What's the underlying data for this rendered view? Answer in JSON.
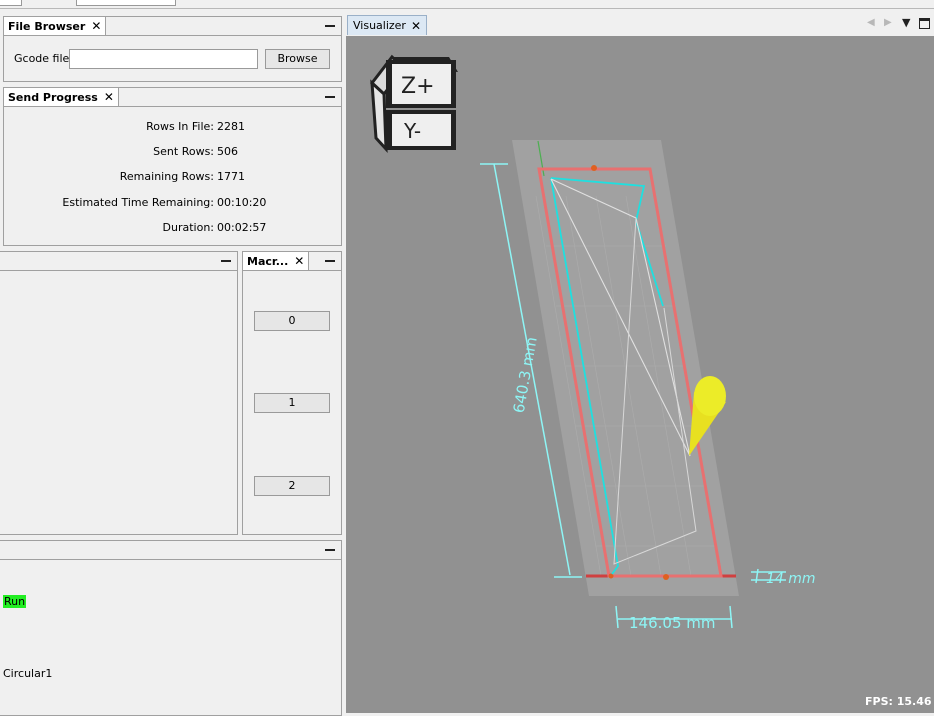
{
  "file_browser": {
    "tab_title": "File Browser",
    "gcode_label": "Gcode file:",
    "gcode_value": "",
    "browse_label": "Browse"
  },
  "send_progress": {
    "tab_title": "Send Progress",
    "rows": [
      {
        "label": "Rows In File:",
        "value": "2281"
      },
      {
        "label": "Sent Rows:",
        "value": "506"
      },
      {
        "label": "Remaining Rows:",
        "value": "1771"
      },
      {
        "label": "Estimated Time Remaining:",
        "value": "00:10:20"
      },
      {
        "label": "Duration:",
        "value": "00:02:57"
      }
    ]
  },
  "macros": {
    "tab_title": "Macr...",
    "buttons": [
      "0",
      "1",
      "2"
    ]
  },
  "bottom_panel": {
    "run_label": "Run",
    "circular_label": "Circular1"
  },
  "visualizer": {
    "tab_title": "Visualizer",
    "cube_top": "Z+",
    "cube_front": "Y-",
    "dim_height": "640.3 mm",
    "dim_width": "146.05 mm",
    "dim_depth": "14 mm",
    "fps": "FPS: 15.46"
  },
  "colors": {
    "viewport_bg": "#919191",
    "dimension": "#8ef5f5",
    "bounding_box": "#e87070",
    "toolpath": "#1ee0e0",
    "tool_cone": "#e8e020",
    "run_highlight": "#22ee22"
  }
}
